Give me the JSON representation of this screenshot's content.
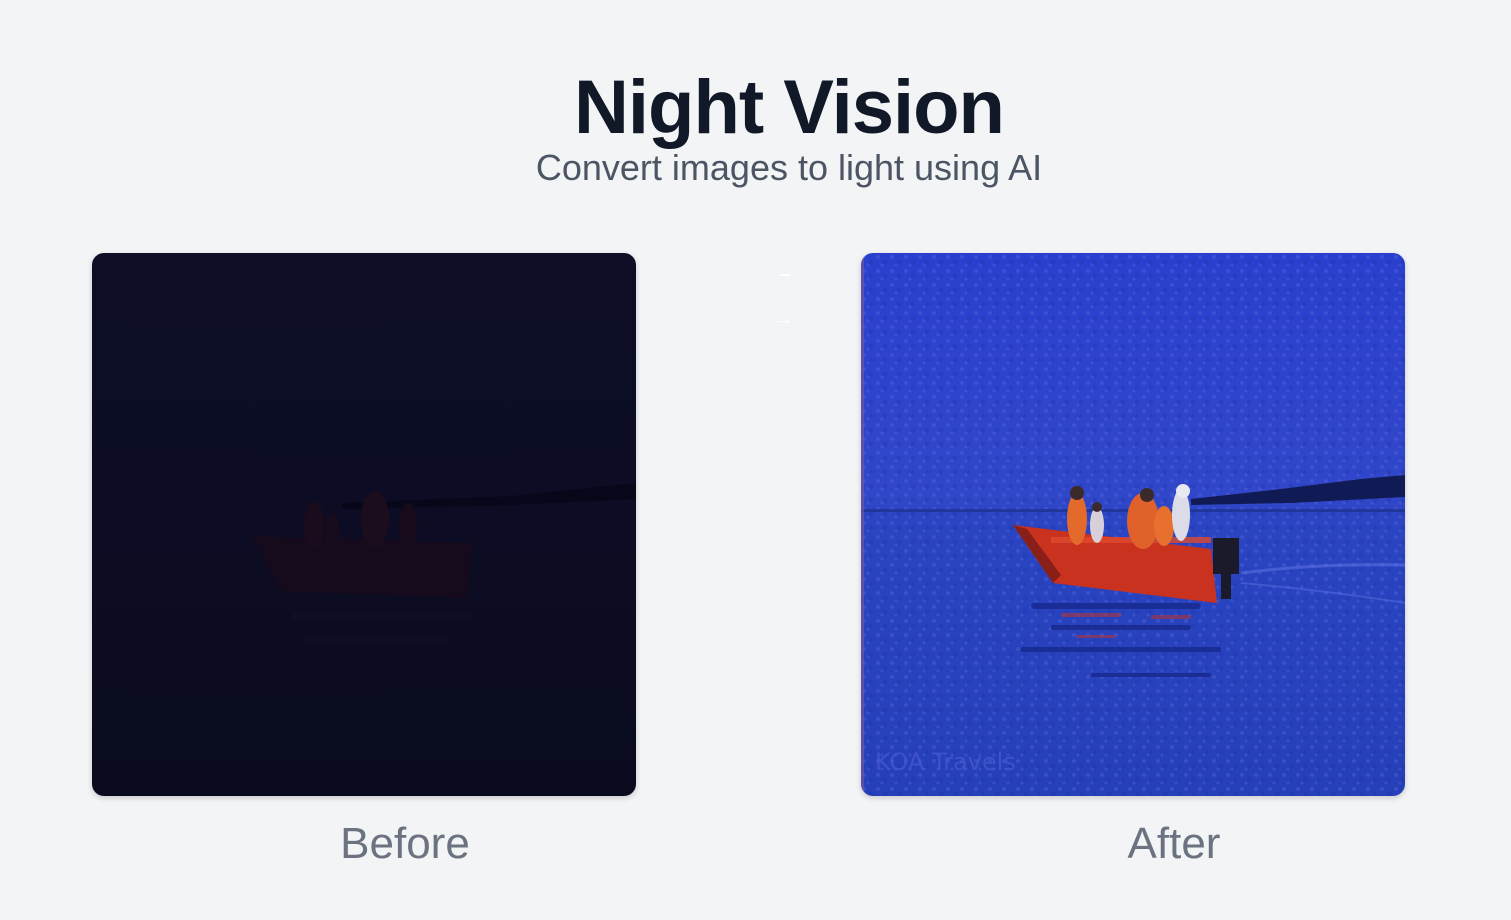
{
  "header": {
    "title": "Night Vision",
    "subtitle": "Convert images to light using AI"
  },
  "comparison": {
    "before_label": "Before",
    "after_label": "After",
    "arrow_glyph": "→",
    "before_image_icon": "dark-boat-photo",
    "after_image_icon": "brightened-boat-photo",
    "after_watermark": "KOA Travels"
  },
  "colors": {
    "background": "#f3f4f6",
    "title": "#111827",
    "subtitle": "#4b5563",
    "caption": "#6b7280",
    "before_photo_base": "#0b0c24",
    "after_photo_base": "#2a3fc4",
    "boat_red": "#c8321e"
  }
}
